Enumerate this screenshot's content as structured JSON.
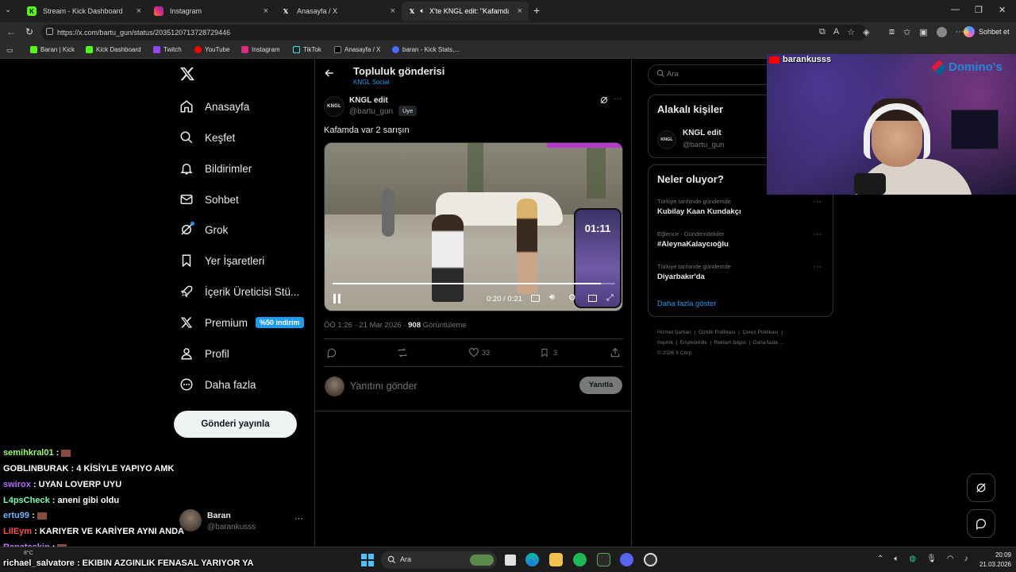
{
  "browser": {
    "tabs": [
      {
        "label": "Stream - Kick Dashboard",
        "icon": "kick-icon",
        "color": "#53fc18"
      },
      {
        "label": "Instagram",
        "icon": "instagram-icon",
        "color": "#e1306c"
      },
      {
        "label": "Anasayfa / X",
        "icon": "x-logo-icon",
        "color": "#000000"
      },
      {
        "label": "X'te KNGL edit: \"Kafamda var",
        "icon": "x-logo-icon",
        "color": "#000000"
      }
    ],
    "url": "https://x.com/bartu_gun/status/2035120713728729446",
    "profile_label": "Sohbet et",
    "bookmarks": [
      "Baran | Kick",
      "Kick Dashboard",
      "Twitch",
      "YouTube",
      "Instagram",
      "TikTok",
      "Anasayfa / X",
      "baran - Kick Stats,..."
    ]
  },
  "sidebar": {
    "items": [
      {
        "label": "Anasayfa",
        "icon": "home-icon"
      },
      {
        "label": "Keşfet",
        "icon": "search-icon"
      },
      {
        "label": "Bildirimler",
        "icon": "bell-icon"
      },
      {
        "label": "Sohbet",
        "icon": "mail-icon"
      },
      {
        "label": "Grok",
        "icon": "grok-icon"
      },
      {
        "label": "Yer İşaretleri",
        "icon": "bookmark-icon"
      },
      {
        "label": "İçerik Üreticisi Stü...",
        "icon": "rocket-icon"
      },
      {
        "label": "Premium",
        "icon": "x-logo-icon"
      },
      {
        "label": "Profil",
        "icon": "person-icon"
      },
      {
        "label": "Daha fazla",
        "icon": "more-circle-icon"
      }
    ],
    "premium_badge": "%50 indirim",
    "post_button": "Gönderi yayınla",
    "account_name": "Baran",
    "account_handle": "@barankusss"
  },
  "post": {
    "header_title": "Topluluk gönderisi",
    "header_sub": "KNGL Social",
    "author_name": "KNGL edit",
    "author_handle": "@bartu_gun",
    "member_badge": "Üye",
    "avatar_text": "KNGL",
    "text": "Kafamda var 2 sarışın",
    "video_time": "0:20 / 0:21",
    "video_progress": 0.95,
    "phone_clock": "01:11",
    "timestamp": "ÖÖ 1:26 · 21 Mar 2026 ·",
    "views_count": "908",
    "views_label": "Görüntüleme",
    "likes": "33",
    "bookmarks": "3",
    "reply_placeholder": "Yanıtını gönder",
    "reply_button": "Yanıtla"
  },
  "right": {
    "search_placeholder": "Ara",
    "related_title": "Alakalı kişiler",
    "related_name": "KNGL edit",
    "related_handle": "@bartu_gun",
    "trends_title": "Neler oluyor?",
    "trends": [
      {
        "context": "Türkiye tarihinde gündemde",
        "name": "Kubilay Kaan Kundakçı"
      },
      {
        "context": "Eğlence · Gündemdekiler",
        "name": "#AleynaKalaycıoğlu"
      },
      {
        "context": "Türkiye tarihinde gündemde",
        "name": "Diyarbakır'da"
      }
    ],
    "show_more": "Daha fazla göster",
    "footer_links_1": [
      "Hizmet Şartları",
      "Gizlilik Politikası",
      "Çerez Politikası"
    ],
    "footer_links_2": [
      "Imprint",
      "Erişilebilirlik",
      "Reklam bilgisi",
      "Daha fazla ..."
    ],
    "copyright": "© 2026 X Corp."
  },
  "webcam": {
    "channel": "barankusss",
    "sponsor": "Domino's"
  },
  "chat": [
    {
      "user": "semihkral01",
      "message": "",
      "color": "#9bff6b"
    },
    {
      "user": "GOBLINBURAK",
      "message": "4 KİSİYLE YAPIYO AMK",
      "color": "#ffffff"
    },
    {
      "user": "swirox",
      "message": "UYAN LOVERP UYU",
      "color": "#b36bff"
    },
    {
      "user": "L4psCheck",
      "message": "aneni gibi oldu",
      "color": "#6bffb0"
    },
    {
      "user": "ertu99",
      "message": "",
      "color": "#6bb5ff"
    },
    {
      "user": "LilEym",
      "message": "KARIYER VE KARİYER AYNI ANDA",
      "color": "#ff4d4d"
    },
    {
      "user": "Ranataskin",
      "message": "",
      "color": "#c77dff"
    },
    {
      "user": "richael_salvatore",
      "message": "EKIBIN AZGINLIK FENASAL YARIYOR YA",
      "color": "#ffffff"
    }
  ],
  "taskbar": {
    "search_label": "Ara",
    "weather": "8°C",
    "time": "20:09",
    "date": "21.03.2026"
  }
}
